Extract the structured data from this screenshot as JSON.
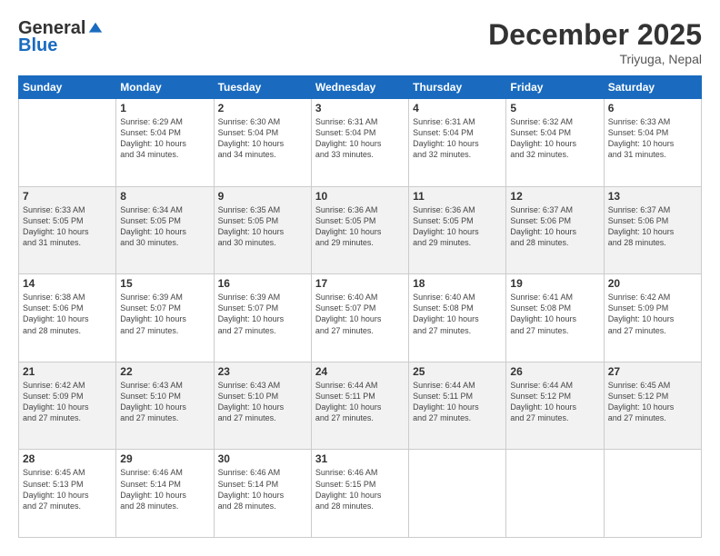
{
  "logo": {
    "general": "General",
    "blue": "Blue"
  },
  "header": {
    "title": "December 2025",
    "location": "Triyuga, Nepal"
  },
  "weekdays": [
    "Sunday",
    "Monday",
    "Tuesday",
    "Wednesday",
    "Thursday",
    "Friday",
    "Saturday"
  ],
  "weeks": [
    [
      {
        "day": "",
        "info": ""
      },
      {
        "day": "1",
        "info": "Sunrise: 6:29 AM\nSunset: 5:04 PM\nDaylight: 10 hours\nand 34 minutes."
      },
      {
        "day": "2",
        "info": "Sunrise: 6:30 AM\nSunset: 5:04 PM\nDaylight: 10 hours\nand 34 minutes."
      },
      {
        "day": "3",
        "info": "Sunrise: 6:31 AM\nSunset: 5:04 PM\nDaylight: 10 hours\nand 33 minutes."
      },
      {
        "day": "4",
        "info": "Sunrise: 6:31 AM\nSunset: 5:04 PM\nDaylight: 10 hours\nand 32 minutes."
      },
      {
        "day": "5",
        "info": "Sunrise: 6:32 AM\nSunset: 5:04 PM\nDaylight: 10 hours\nand 32 minutes."
      },
      {
        "day": "6",
        "info": "Sunrise: 6:33 AM\nSunset: 5:04 PM\nDaylight: 10 hours\nand 31 minutes."
      }
    ],
    [
      {
        "day": "7",
        "info": "Sunrise: 6:33 AM\nSunset: 5:05 PM\nDaylight: 10 hours\nand 31 minutes."
      },
      {
        "day": "8",
        "info": "Sunrise: 6:34 AM\nSunset: 5:05 PM\nDaylight: 10 hours\nand 30 minutes."
      },
      {
        "day": "9",
        "info": "Sunrise: 6:35 AM\nSunset: 5:05 PM\nDaylight: 10 hours\nand 30 minutes."
      },
      {
        "day": "10",
        "info": "Sunrise: 6:36 AM\nSunset: 5:05 PM\nDaylight: 10 hours\nand 29 minutes."
      },
      {
        "day": "11",
        "info": "Sunrise: 6:36 AM\nSunset: 5:05 PM\nDaylight: 10 hours\nand 29 minutes."
      },
      {
        "day": "12",
        "info": "Sunrise: 6:37 AM\nSunset: 5:06 PM\nDaylight: 10 hours\nand 28 minutes."
      },
      {
        "day": "13",
        "info": "Sunrise: 6:37 AM\nSunset: 5:06 PM\nDaylight: 10 hours\nand 28 minutes."
      }
    ],
    [
      {
        "day": "14",
        "info": "Sunrise: 6:38 AM\nSunset: 5:06 PM\nDaylight: 10 hours\nand 28 minutes."
      },
      {
        "day": "15",
        "info": "Sunrise: 6:39 AM\nSunset: 5:07 PM\nDaylight: 10 hours\nand 27 minutes."
      },
      {
        "day": "16",
        "info": "Sunrise: 6:39 AM\nSunset: 5:07 PM\nDaylight: 10 hours\nand 27 minutes."
      },
      {
        "day": "17",
        "info": "Sunrise: 6:40 AM\nSunset: 5:07 PM\nDaylight: 10 hours\nand 27 minutes."
      },
      {
        "day": "18",
        "info": "Sunrise: 6:40 AM\nSunset: 5:08 PM\nDaylight: 10 hours\nand 27 minutes."
      },
      {
        "day": "19",
        "info": "Sunrise: 6:41 AM\nSunset: 5:08 PM\nDaylight: 10 hours\nand 27 minutes."
      },
      {
        "day": "20",
        "info": "Sunrise: 6:42 AM\nSunset: 5:09 PM\nDaylight: 10 hours\nand 27 minutes."
      }
    ],
    [
      {
        "day": "21",
        "info": "Sunrise: 6:42 AM\nSunset: 5:09 PM\nDaylight: 10 hours\nand 27 minutes."
      },
      {
        "day": "22",
        "info": "Sunrise: 6:43 AM\nSunset: 5:10 PM\nDaylight: 10 hours\nand 27 minutes."
      },
      {
        "day": "23",
        "info": "Sunrise: 6:43 AM\nSunset: 5:10 PM\nDaylight: 10 hours\nand 27 minutes."
      },
      {
        "day": "24",
        "info": "Sunrise: 6:44 AM\nSunset: 5:11 PM\nDaylight: 10 hours\nand 27 minutes."
      },
      {
        "day": "25",
        "info": "Sunrise: 6:44 AM\nSunset: 5:11 PM\nDaylight: 10 hours\nand 27 minutes."
      },
      {
        "day": "26",
        "info": "Sunrise: 6:44 AM\nSunset: 5:12 PM\nDaylight: 10 hours\nand 27 minutes."
      },
      {
        "day": "27",
        "info": "Sunrise: 6:45 AM\nSunset: 5:12 PM\nDaylight: 10 hours\nand 27 minutes."
      }
    ],
    [
      {
        "day": "28",
        "info": "Sunrise: 6:45 AM\nSunset: 5:13 PM\nDaylight: 10 hours\nand 27 minutes."
      },
      {
        "day": "29",
        "info": "Sunrise: 6:46 AM\nSunset: 5:14 PM\nDaylight: 10 hours\nand 28 minutes."
      },
      {
        "day": "30",
        "info": "Sunrise: 6:46 AM\nSunset: 5:14 PM\nDaylight: 10 hours\nand 28 minutes."
      },
      {
        "day": "31",
        "info": "Sunrise: 6:46 AM\nSunset: 5:15 PM\nDaylight: 10 hours\nand 28 minutes."
      },
      {
        "day": "",
        "info": ""
      },
      {
        "day": "",
        "info": ""
      },
      {
        "day": "",
        "info": ""
      }
    ]
  ]
}
